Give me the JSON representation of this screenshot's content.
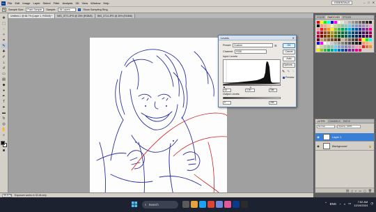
{
  "menubar": {
    "logo": "Ps",
    "items": [
      "File",
      "Edit",
      "Image",
      "Layer",
      "Select",
      "Filter",
      "Analysis",
      "3D",
      "View",
      "Window",
      "Help"
    ],
    "workspace": "ESSENTIALS",
    "win_min": "–",
    "win_max": "□",
    "win_close": "✕"
  },
  "options": {
    "sample_size_label": "Sample Size:",
    "sample_size_value": "Point Sample",
    "sample_label": "Sample:",
    "sample_value": "All Layers",
    "show_ring_label": "Show Sampling Ring"
  },
  "tabs": [
    {
      "label": "Untitled-1 @ 66.7% (Layer 1, RGB/8) *"
    },
    {
      "label": "IMG_3771.JPG @ 25% (RGB/8)"
    },
    {
      "label": "IMG_3714.JPG @ 25% (RGB/8)"
    }
  ],
  "status": {
    "zoom": "66.67%",
    "info": "Exposure works in 32-bit only"
  },
  "levels": {
    "title": "Levels",
    "close": "✕",
    "preset_label": "Preset:",
    "preset_value": "Custom",
    "channel_label": "Channel:",
    "channel_value": "RGB",
    "input_label": "Input Levels:",
    "input_black": "43",
    "input_gamma": "1.00",
    "input_white": "186",
    "output_label": "Output Levels:",
    "output_black": "0",
    "output_white": "255",
    "ok": "OK",
    "cancel": "Cancel",
    "auto": "Auto",
    "options": "Options...",
    "preview_label": "Preview"
  },
  "swatch_tabs": [
    "COLOR",
    "SWATCHES",
    "STYLES"
  ],
  "swatch_colors": [
    "#ff0000",
    "#ffff00",
    "#00ff00",
    "#00ffff",
    "#0000ff",
    "#ff00ff",
    "#ffffff",
    "#e6e6e6",
    "#cccccc",
    "#b3b3b3",
    "#999999",
    "#808080",
    "#666666",
    "#4d4d4d",
    "#333333",
    "#1a1a1a",
    "#000000",
    "#f7977a",
    "#f9ad81",
    "#fdc68a",
    "#fff79a",
    "#c4df9b",
    "#a2d39c",
    "#82ca9d",
    "#7bcdc8",
    "#6ecff6",
    "#7ea7d8",
    "#8493ca",
    "#8882be",
    "#a187be",
    "#bc8dbf",
    "#f49ac2",
    "#f6989d",
    "#ed1c24",
    "#f26522",
    "#f7941d",
    "#fff200",
    "#8dc63f",
    "#39b54a",
    "#00a651",
    "#00a99d",
    "#00aeef",
    "#0072bc",
    "#0054a6",
    "#2e3192",
    "#662d91",
    "#92278f",
    "#ec008c",
    "#ed145b",
    "#9e0b0f",
    "#a0410d",
    "#a36209",
    "#aba000",
    "#598527",
    "#1a7b30",
    "#007236",
    "#00746b",
    "#0076a3",
    "#004b80",
    "#003471",
    "#1b1464",
    "#440e62",
    "#630460",
    "#9e005d",
    "#9e0039",
    "#790000",
    "#7b2e00",
    "#7d4900",
    "#827b00",
    "#406618",
    "#005e20",
    "#005826",
    "#005952",
    "#005b7f",
    "#003663",
    "#002157",
    "#0d004c",
    "#32004b",
    "#4b0049",
    "#7b0046",
    "#7a0026",
    "#c69c6d",
    "#a67c52",
    "#8c6239",
    "#754c24",
    "#603913",
    "#42210b",
    "#c7b299",
    "#998675",
    "#736357",
    "#534741",
    "#362f2d",
    "#ff0000",
    "#ffff00",
    "#00ff00",
    "#00ffff",
    "#0000ff",
    "#ff00ff",
    "#ffffff",
    "#e6e6e6",
    "#cccccc",
    "#b3b3b3",
    "#999999",
    "#808080",
    "#666666",
    "#4d4d4d",
    "#333333",
    "#1a1a1a",
    "#000000",
    "#f7977a",
    "#f9ad81",
    "#fdc68a",
    "#fff79a",
    "#c4df9b",
    "#a2d39c",
    "#82ca9d",
    "#7bcdc8",
    "#6ecff6",
    "#7ea7d8",
    "#8493ca",
    "#8882be",
    "#a187be",
    "#bc8dbf",
    "#f49ac2",
    "#f6989d",
    "#ed1c24",
    "#f26522",
    "#f7941d",
    "#fff200",
    "#8dc63f",
    "#39b54a",
    "#00a651",
    "#00a99d",
    "#00aeef",
    "#0072bc",
    "#0054a6",
    "#2e3192",
    "#662d91",
    "#92278f",
    "#ec008c",
    "#ed145b"
  ],
  "layers_panel": {
    "tabs": [
      "LAYERS",
      "CHANNELS",
      "PATHS"
    ],
    "blend": "Normal",
    "opacity": "Opacity: 100%",
    "layer1": "Layer 1",
    "background": "Background"
  },
  "taskbar": {
    "search_placeholder": "Search",
    "lang": "ENG",
    "time": "7:52 AM",
    "date": "12/19/2024"
  }
}
